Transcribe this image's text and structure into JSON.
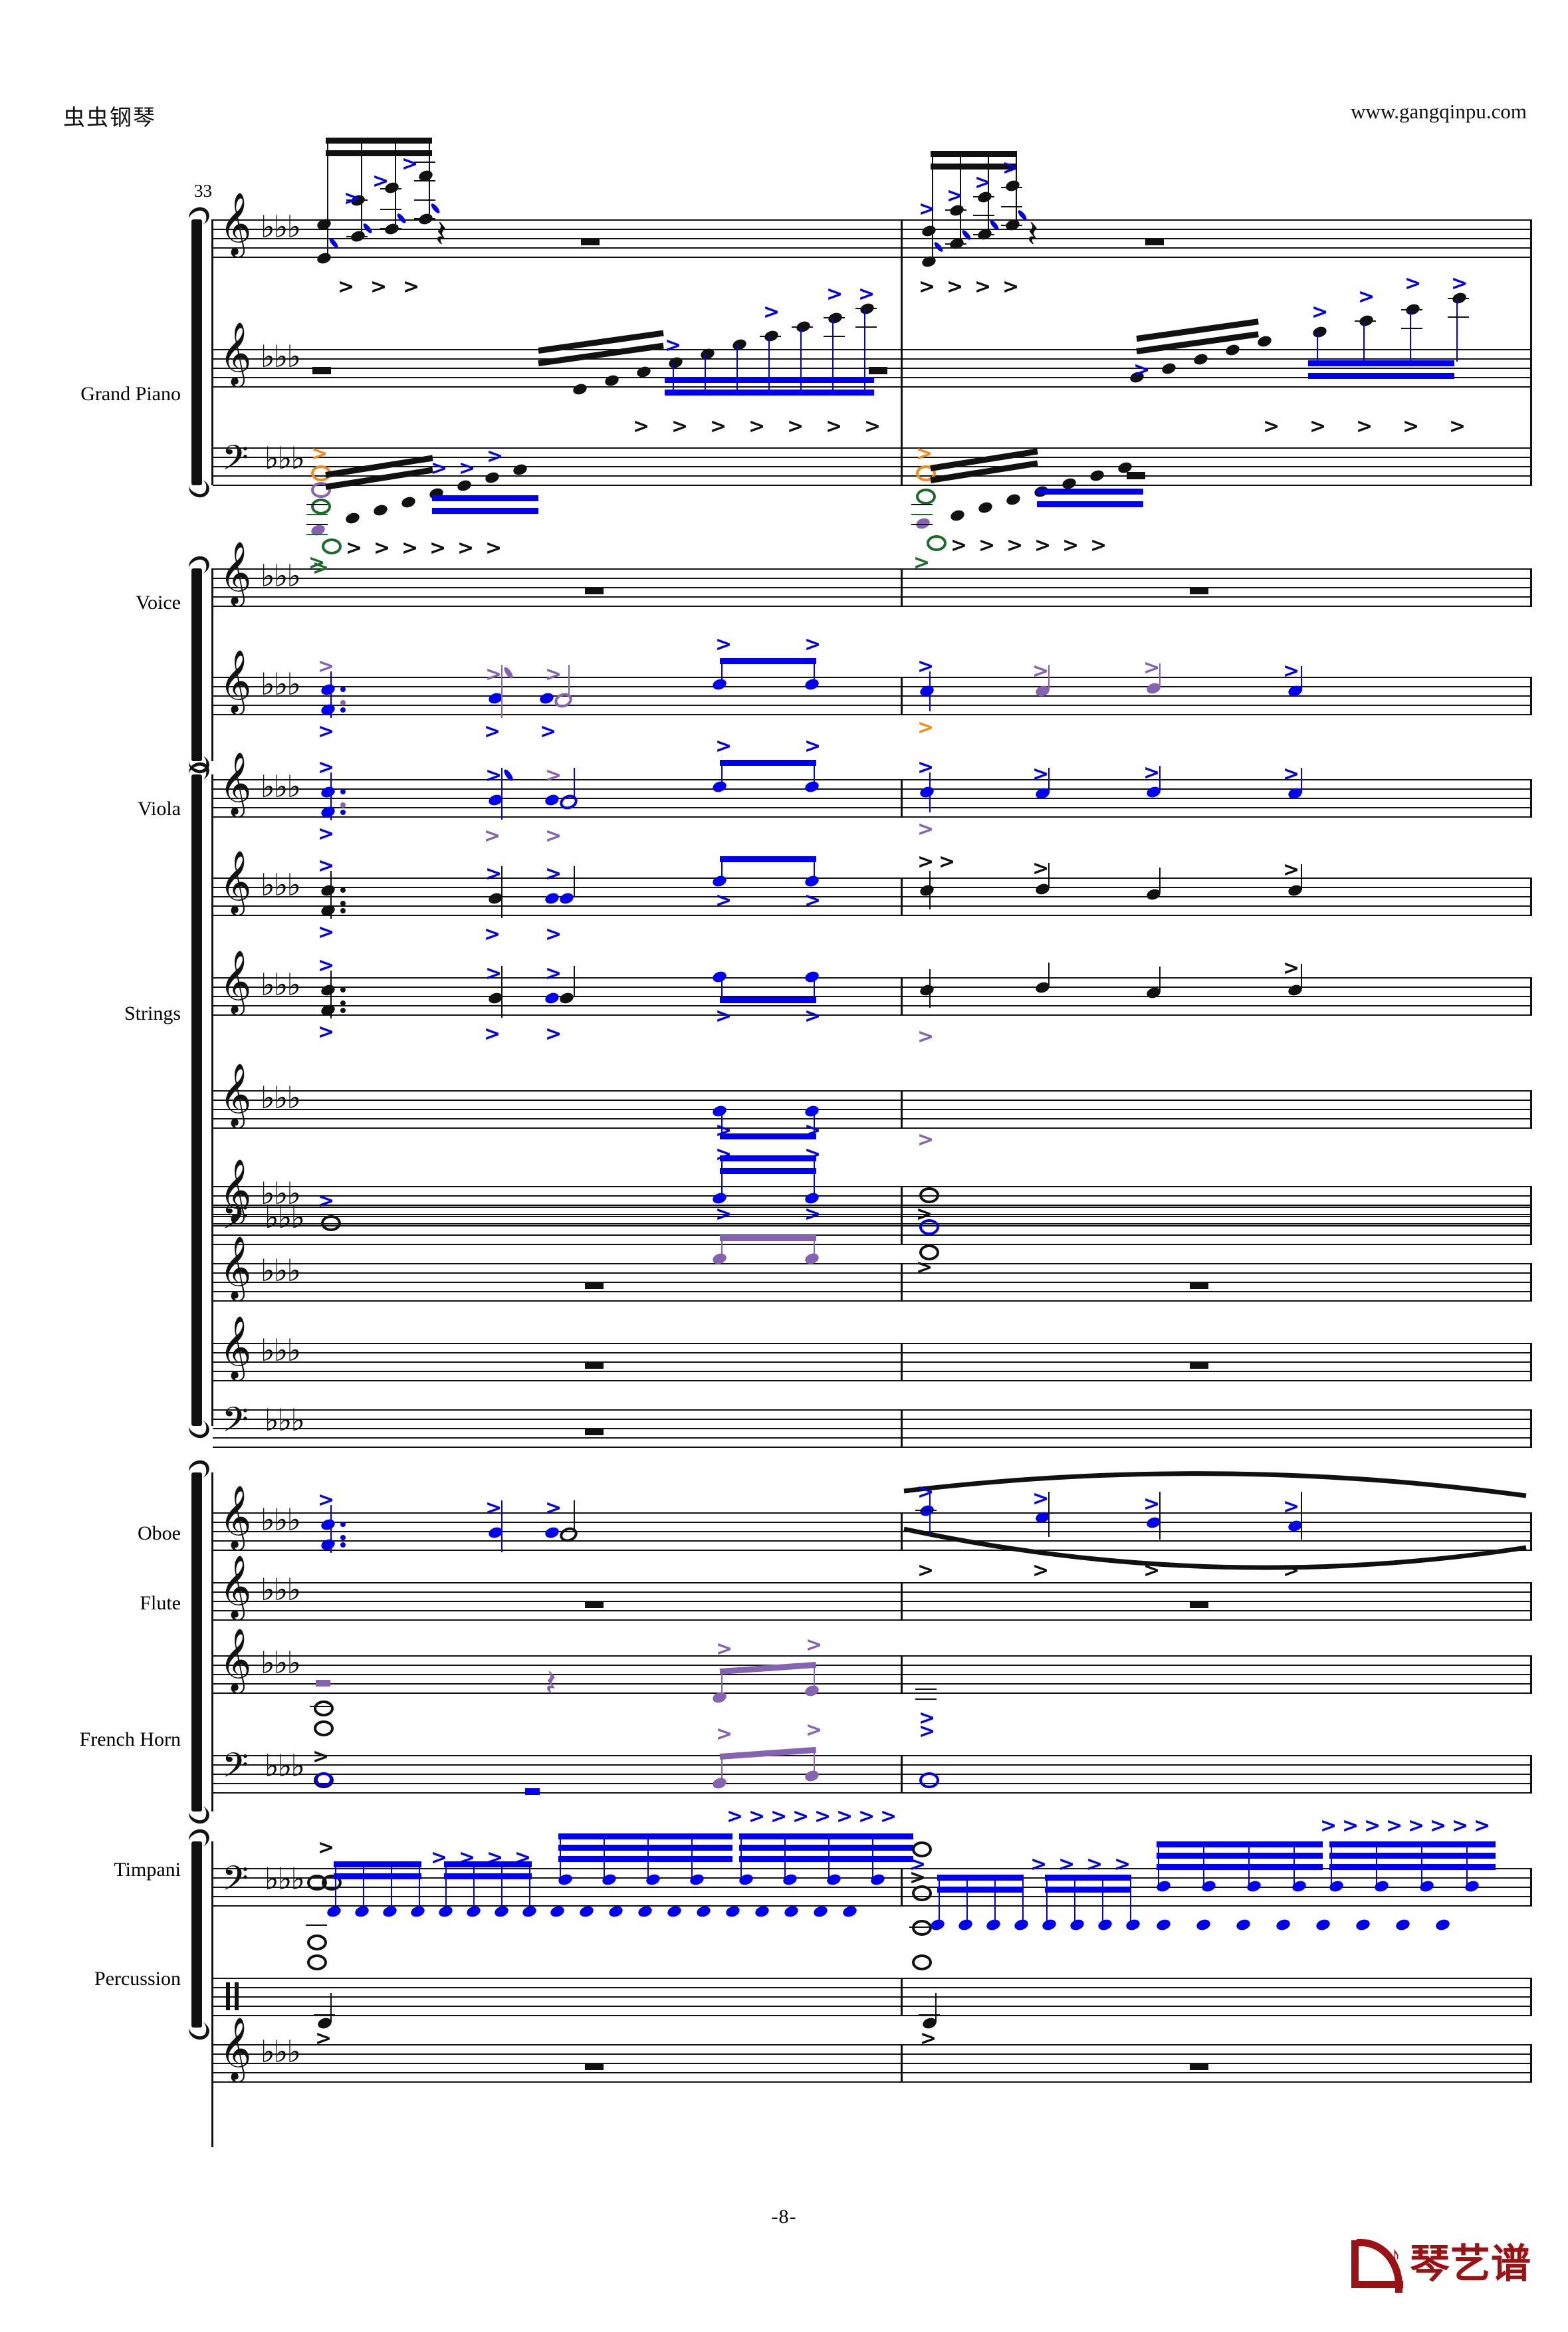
{
  "document": {
    "type": "orchestral-score",
    "page_number": "-8-",
    "measure_number": "33",
    "key_signature": "3 flats (E-flat major / C minor)",
    "staff_systems": 1,
    "measures_on_page": 2
  },
  "header": {
    "site_name": "虫虫钢琴",
    "site_url": "www.gangqinpu.com"
  },
  "footer": {
    "page_label": "-8-",
    "logo_text": "琴艺谱",
    "logo_note_glyph": "♪",
    "logo_color": "#9b1214"
  },
  "instruments": [
    {
      "id": "grand-piano",
      "label": "Grand Piano",
      "staff_count": 3,
      "clefs": [
        "treble",
        "treble",
        "bass"
      ]
    },
    {
      "id": "voice",
      "label": "Voice",
      "staff_count": 2,
      "clefs": [
        "treble",
        "treble"
      ]
    },
    {
      "id": "viola",
      "label": "Viola",
      "staff_count": 2,
      "clefs": [
        "treble",
        "treble"
      ]
    },
    {
      "id": "strings",
      "label": "Strings",
      "staff_count": 6,
      "clefs": [
        "treble",
        "treble",
        "treble",
        "bass",
        "treble",
        "treble"
      ]
    },
    {
      "id": "oboe",
      "label": "Oboe",
      "staff_count": 1,
      "clefs": [
        "treble"
      ]
    },
    {
      "id": "flute",
      "label": "Flute",
      "staff_count": 1,
      "clefs": [
        "treble"
      ]
    },
    {
      "id": "french-horn",
      "label": "French Horn",
      "staff_count": 2,
      "clefs": [
        "treble",
        "bass"
      ]
    },
    {
      "id": "timpani",
      "label": "Timpani",
      "staff_count": 1,
      "clefs": [
        "bass"
      ]
    },
    {
      "id": "percussion",
      "label": "Percussion",
      "staff_count": 2,
      "clefs": [
        "percussion",
        "treble"
      ]
    }
  ],
  "colors": {
    "note_blue": "#0000ee",
    "note_black": "#111111",
    "note_purple": "#8464b0",
    "note_green": "#1d6b2b",
    "note_orange": "#f08c18",
    "logo_red": "#9b1214",
    "staff_line": "#111111"
  },
  "symbols": {
    "treble_clef": "𝄞",
    "bass_clef": "𝄢",
    "flat": "♭",
    "quarter_rest": "𝄽",
    "accent": ">",
    "whole_rest": "▬"
  },
  "notation_summary": {
    "dynamics_markings": "accent (>) marks throughout, colored by voice",
    "note_values_present": [
      "whole",
      "half",
      "dotted quarter",
      "eighth",
      "sixteenth",
      "thirty-second"
    ],
    "beams": "multi-level blue and purple beams in ascending runs",
    "slur_present_on": "Oboe, measure 2",
    "rests_present": [
      "whole rest",
      "quarter rest"
    ]
  }
}
